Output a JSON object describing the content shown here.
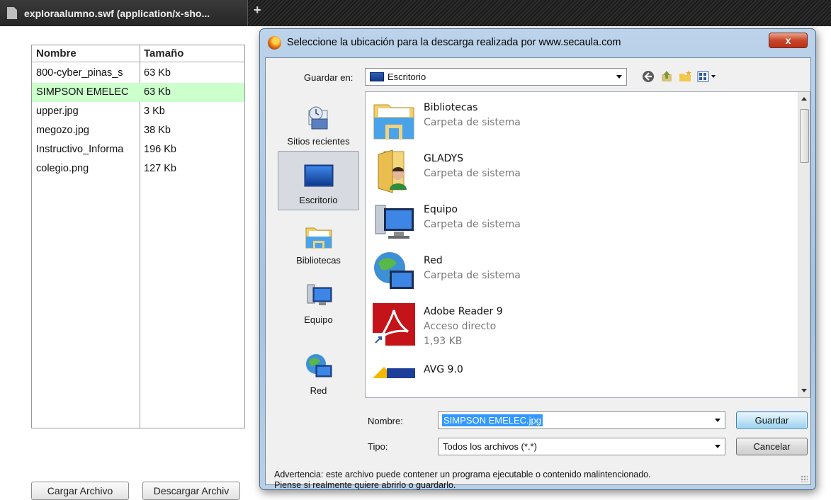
{
  "browser": {
    "tab_title": "exploraalumno.swf (application/x-sho...",
    "newtab_symbol": "+"
  },
  "file_list": {
    "headers": {
      "name": "Nombre",
      "size": "Tamaño"
    },
    "rows": [
      {
        "name": "800-cyber_pinas_s",
        "size": "63 Kb",
        "selected": false
      },
      {
        "name": "SIMPSON EMELEC",
        "size": "63 Kb",
        "selected": true
      },
      {
        "name": "upper.jpg",
        "size": "3 Kb",
        "selected": false
      },
      {
        "name": "megozo.jpg",
        "size": "38 Kb",
        "selected": false
      },
      {
        "name": "Instructivo_Informa",
        "size": "196 Kb",
        "selected": false
      },
      {
        "name": "colegio.png",
        "size": "127 Kb",
        "selected": false
      }
    ],
    "selected_color": "#ccffcc"
  },
  "actions": {
    "load_label": "Cargar Archivo",
    "download_label": "Descargar Archiv"
  },
  "dialog": {
    "title": "Seleccione la ubicación para la descarga realizada por www.secaula.com",
    "close_symbol": "x",
    "save_in_label": "Guardar en:",
    "save_in_value": "Escritorio",
    "toolbar_icons": [
      "back-icon",
      "up-folder-icon",
      "new-folder-icon",
      "view-menu-icon"
    ],
    "places": [
      {
        "label": "Sitios recientes",
        "icon": "recent-places-icon",
        "selected": false
      },
      {
        "label": "Escritorio",
        "icon": "desktop-icon",
        "selected": true
      },
      {
        "label": "Bibliotecas",
        "icon": "libraries-icon",
        "selected": false
      },
      {
        "label": "Equipo",
        "icon": "computer-icon",
        "selected": false
      },
      {
        "label": "Red",
        "icon": "network-icon",
        "selected": false
      }
    ],
    "items": [
      {
        "name": "Bibliotecas",
        "type": "Carpeta de sistema",
        "size": "",
        "icon": "libraries-icon"
      },
      {
        "name": "GLADYS",
        "type": "Carpeta de sistema",
        "size": "",
        "icon": "user-folder-icon"
      },
      {
        "name": "Equipo",
        "type": "Carpeta de sistema",
        "size": "",
        "icon": "computer-icon"
      },
      {
        "name": "Red",
        "type": "Carpeta de sistema",
        "size": "",
        "icon": "network-icon"
      },
      {
        "name": "Adobe Reader 9",
        "type": "Acceso directo",
        "size": "1,93 KB",
        "icon": "adobe-reader-icon"
      },
      {
        "name": "AVG 9.0",
        "type": "",
        "size": "",
        "icon": "avg-icon"
      }
    ],
    "filename_label": "Nombre:",
    "filename_value": "SIMPSON EMELEC.jpg",
    "filetype_label": "Tipo:",
    "filetype_value": "Todos los archivos (*.*)",
    "save_button": "Guardar",
    "cancel_button": "Cancelar",
    "warning_line1": "Advertencia: este archivo puede contener un programa ejecutable o contenido malintencionado.",
    "warning_line2": "Piense si realmente quiere abrirlo o guardarlo."
  }
}
